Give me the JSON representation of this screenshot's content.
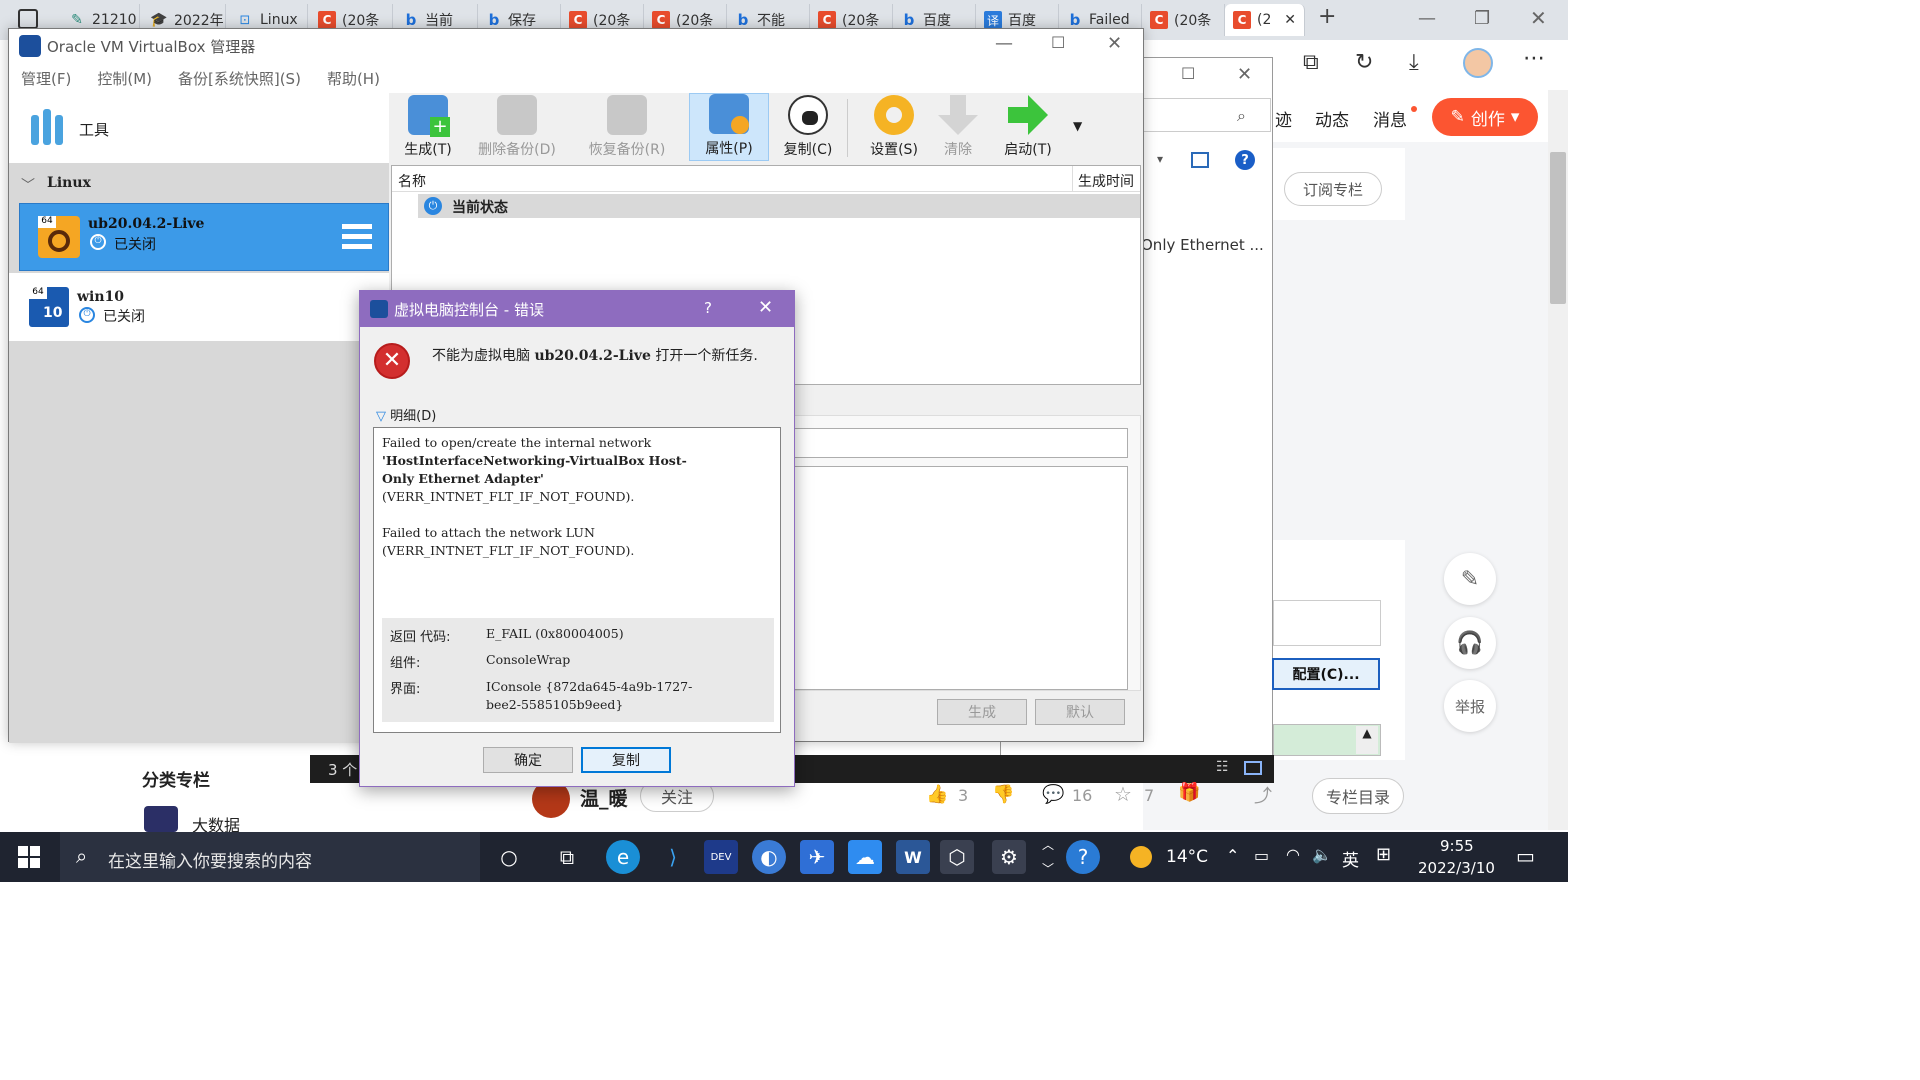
{
  "browser": {
    "tabs": [
      {
        "icon": "pen-icon",
        "label": "21210"
      },
      {
        "icon": "graduation-cap-icon",
        "label": "2022年"
      },
      {
        "icon": "bot-icon",
        "label": "Linux"
      },
      {
        "icon": "csdn-icon",
        "label": "(20条"
      },
      {
        "icon": "bing-icon",
        "label": "当前"
      },
      {
        "icon": "bing-icon",
        "label": "保存"
      },
      {
        "icon": "csdn-icon",
        "label": "(20条"
      },
      {
        "icon": "csdn-icon",
        "label": "(20条"
      },
      {
        "icon": "bing-icon",
        "label": "不能"
      },
      {
        "icon": "csdn-icon",
        "label": "(20条"
      },
      {
        "icon": "bing-icon",
        "label": "百度"
      },
      {
        "icon": "translate-icon",
        "label": "百度"
      },
      {
        "icon": "bing-icon",
        "label": "Failed"
      },
      {
        "icon": "csdn-icon",
        "label": "(20条"
      },
      {
        "icon": "csdn-icon",
        "label": "(2"
      }
    ],
    "new_tab": "+",
    "nav": {
      "trail": "迹",
      "dynamic": "动态",
      "messages": "消息",
      "create": "创作"
    },
    "subscribe": "订阅专栏",
    "bg_text": "Only Ethernet ...",
    "config_btn": "配置(C)...",
    "report": "举报",
    "category_title": "分类专栏",
    "category_item": "大数据",
    "author": "温_暖",
    "follow": "关注",
    "likes": "3",
    "comments": "16",
    "stars": "7",
    "column_dir": "专栏目录",
    "count_prefix": "3 个"
  },
  "vbox": {
    "title": "Oracle VM VirtualBox 管理器",
    "menu": [
      "管理(F)",
      "控制(M)",
      "备份[系统快照](S)",
      "帮助(H)"
    ],
    "tools_label": "工具",
    "group": "Linux",
    "vms": [
      {
        "name": "ub20.04.2-Live",
        "state": "已关闭",
        "badge": "64"
      },
      {
        "name": "win10",
        "state": "已关闭",
        "badge": "64"
      }
    ],
    "toolbar": [
      {
        "label": "生成(T)",
        "enabled": true
      },
      {
        "label": "删除备份(D)",
        "enabled": false
      },
      {
        "label": "恢复备份(R)",
        "enabled": false
      },
      {
        "label": "属性(P)",
        "enabled": true
      },
      {
        "label": "复制(C)",
        "enabled": true
      },
      {
        "label": "设置(S)",
        "enabled": true
      },
      {
        "label": "清除",
        "enabled": false
      },
      {
        "label": "启动(T)",
        "enabled": true
      }
    ],
    "columns": {
      "name": "名称",
      "time": "生成时间"
    },
    "current_state": "当前状态",
    "btn_generate": "生成",
    "btn_default": "默认"
  },
  "dialog": {
    "title": "虚拟电脑控制台 - 错误",
    "help": "?",
    "message_pre": "不能为虚拟电脑 ",
    "message_vm": "ub20.04.2-Live",
    "message_post": " 打开一个新任务.",
    "details_label": "明细(D)",
    "detail_line1": "Failed to open/create the internal network",
    "detail_line2": "'HostInterfaceNetworking-VirtualBox  Host-",
    "detail_line3": "Only  Ethernet  Adapter'",
    "detail_line4": "(VERR_INTNET_FLT_IF_NOT_FOUND).",
    "detail_line5": "Failed to attach the network LUN",
    "detail_line6": "(VERR_INTNET_FLT_IF_NOT_FOUND).",
    "return_label": "返回  代码:",
    "return_value": "E_FAIL (0x80004005)",
    "component_label": "组件:",
    "component_value": "ConsoleWrap",
    "interface_label": "界面:",
    "interface_value1": "IConsole {872da645-4a9b-1727-",
    "interface_value2": "bee2-5585105b9eed}",
    "ok": "确定",
    "copy": "复制"
  },
  "taskbar": {
    "search_placeholder": "在这里输入你要搜索的内容",
    "weather": "14°C",
    "ime": "英",
    "time": "9:55",
    "date": "2022/3/10"
  }
}
